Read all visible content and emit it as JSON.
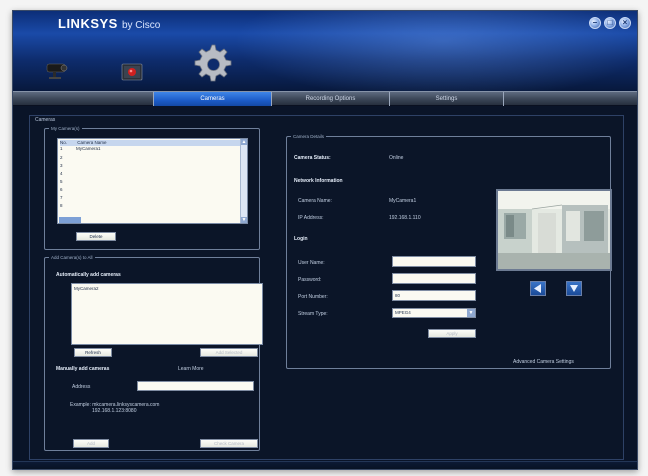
{
  "header": {
    "brand": "LINKSYS",
    "brand_suffix": "by Cisco",
    "window_buttons": [
      "–",
      "□",
      "×"
    ]
  },
  "nav_icons": [
    "camera-icon",
    "recording-icon",
    "settings-gear-icon"
  ],
  "tabs": [
    {
      "label": "Cameras",
      "active": true
    },
    {
      "label": "Recording Options",
      "active": false
    },
    {
      "label": "Settings",
      "active": false
    }
  ],
  "content": {
    "title": "Cameras",
    "my_cameras": {
      "legend": "My Camera(s)",
      "columns": [
        "No.",
        "Camera Name"
      ],
      "rows": [
        {
          "no": "1",
          "name": "MyCamera1"
        },
        {
          "no": "2",
          "name": ""
        },
        {
          "no": "3",
          "name": ""
        },
        {
          "no": "4",
          "name": ""
        },
        {
          "no": "5",
          "name": ""
        },
        {
          "no": "6",
          "name": ""
        },
        {
          "no": "7",
          "name": ""
        },
        {
          "no": "8",
          "name": ""
        }
      ],
      "delete_label": "Delete"
    },
    "add_camera": {
      "legend": "Add Camera(s) to All",
      "auto_heading": "Automatically add cameras",
      "auto_list": [
        "MyCamera2"
      ],
      "refresh_label": "Refresh",
      "add_selected_label": "Add Selected",
      "manual_heading": "Manually add cameras",
      "learn_more": "Learn More",
      "address_label": "Address",
      "address_value": "",
      "example_line1": "Example: mkcamera.linksyscamera.com",
      "example_line2": "192.168.1.123:8080",
      "add_label": "Add",
      "check_label": "Check Camera"
    },
    "camera_details": {
      "legend": "Camera Details",
      "status_label": "Camera Status:",
      "status_value": "Online",
      "network_heading": "Network Information",
      "name_label": "Camera Name:",
      "name_value": "MyCamera1",
      "ip_label": "IP Address:",
      "ip_value": "192.168.1.110",
      "login_heading": "Login",
      "user_label": "User Name:",
      "user_value": "",
      "password_label": "Password:",
      "password_value": "",
      "port_label": "Port Number:",
      "port_value": "80",
      "stream_label": "Stream Type:",
      "stream_value": "MPEG4",
      "apply_label": "Apply",
      "advanced_link": "Advanced Camera Settings"
    }
  },
  "colors": {
    "header_blue": "#1a4aa8",
    "active_tab": "#1c5cc8",
    "panel_bg": "#0b1528"
  }
}
